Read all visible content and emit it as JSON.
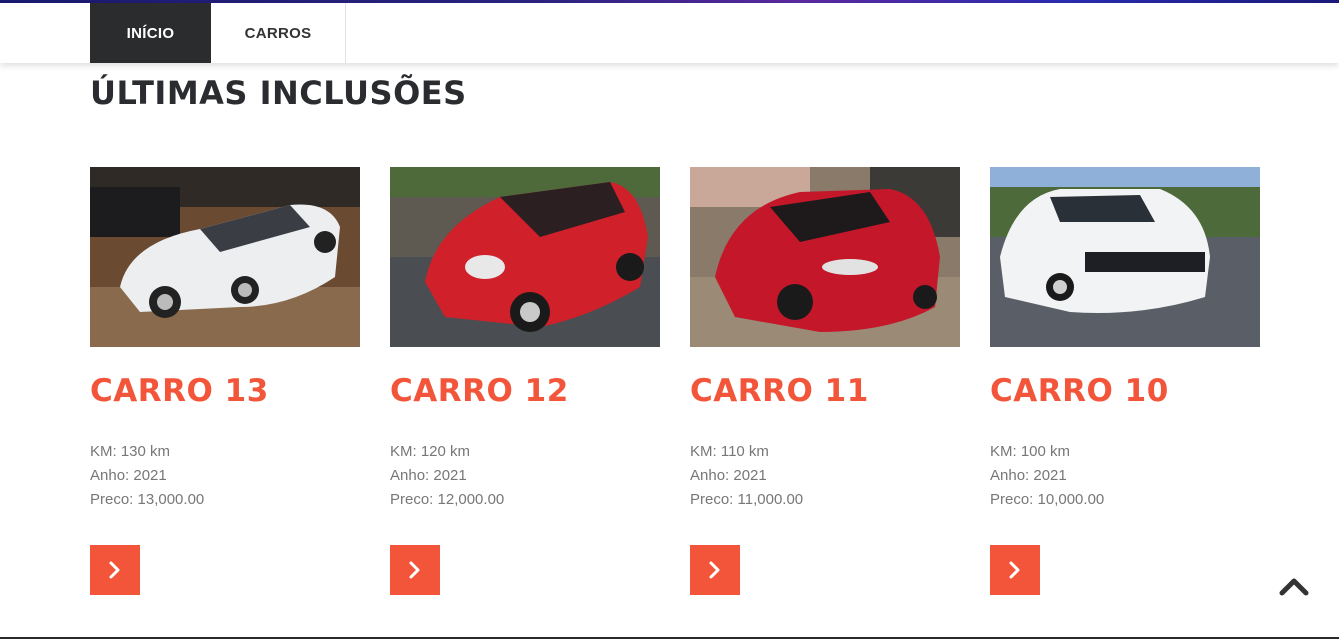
{
  "nav": {
    "items": [
      {
        "label": "INÍCIO",
        "active": true
      },
      {
        "label": "CARROS",
        "active": false
      }
    ]
  },
  "section": {
    "title": "ÚLTIMAS INCLUSÕES"
  },
  "cars": [
    {
      "title": "CARRO 13",
      "km": "KM: 130 km",
      "year": "Anho: 2021",
      "price": "Preco: 13,000.00",
      "color": "white"
    },
    {
      "title": "CARRO 12",
      "km": "KM: 120 km",
      "year": "Anho: 2021",
      "price": "Preco: 12,000.00",
      "color": "red"
    },
    {
      "title": "CARRO 11",
      "km": "KM: 110 km",
      "year": "Anho: 2021",
      "price": "Preco: 11,000.00",
      "color": "red"
    },
    {
      "title": "CARRO 10",
      "km": "KM: 100 km",
      "year": "Anho: 2021",
      "price": "Preco: 10,000.00",
      "color": "white"
    }
  ],
  "icons": {
    "more_button": "chevron-right-icon",
    "back_to_top": "chevron-up-icon"
  },
  "colors": {
    "accent": "#f2553a",
    "nav_active_bg": "#2a2c2e",
    "title_dark": "#2a2c30",
    "spec_text": "#777777"
  }
}
